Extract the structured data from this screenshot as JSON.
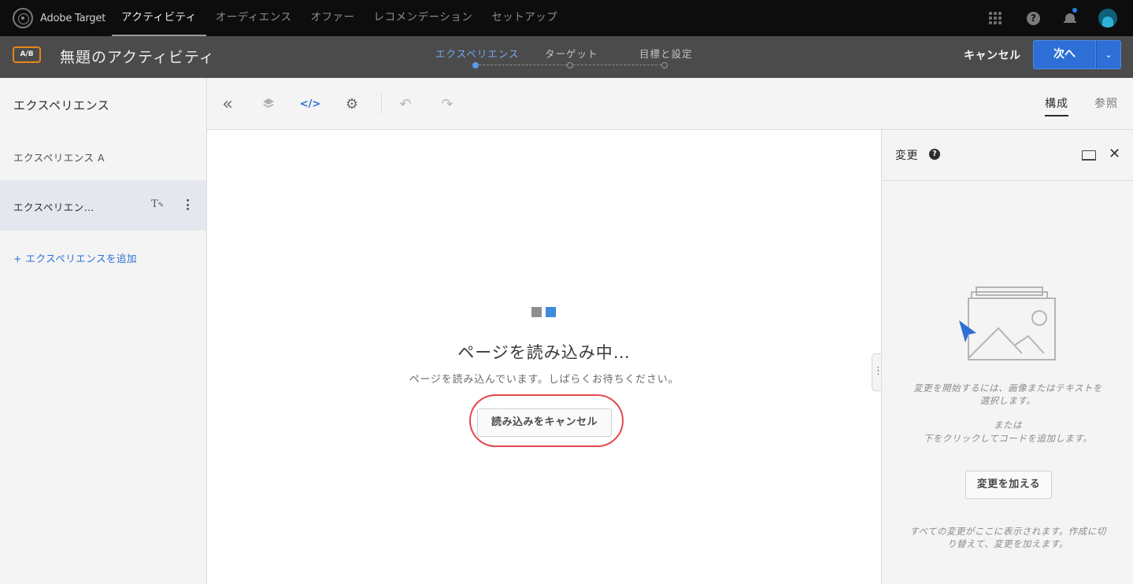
{
  "topnav": {
    "brand": "Adobe Target",
    "items": [
      {
        "label": "アクティビティ",
        "active": true
      },
      {
        "label": "オーディエンス",
        "active": false
      },
      {
        "label": "オファー",
        "active": false
      },
      {
        "label": "レコメンデーション",
        "active": false
      },
      {
        "label": "セットアップ",
        "active": false
      }
    ],
    "help_glyph": "?"
  },
  "activity": {
    "badge": "A/B",
    "title": "無題のアクティビティ",
    "steps": [
      {
        "label": "エクスペリエンス",
        "active": true
      },
      {
        "label": "ターゲット",
        "active": false
      },
      {
        "label": "目標と設定",
        "active": false
      }
    ],
    "cancel_label": "キャンセル",
    "next_label": "次へ",
    "dropdown_glyph": "⌄"
  },
  "sidebar": {
    "heading": "エクスペリエンス",
    "experience_a": "エクスペリエンス A",
    "selected_experience": "エクスペリエン…",
    "rename_glyph": "T",
    "add_label": "+ エクスペリエンスを追加"
  },
  "toolbar": {
    "icons": [
      "collapse-icon",
      "layers-icon",
      "code-icon",
      "settings-icon",
      "undo-icon",
      "redo-icon"
    ],
    "collapse_glyph": "«",
    "code_glyph": "</>",
    "settings_glyph": "⚙",
    "undo_glyph": "↶",
    "redo_glyph": "↷",
    "tab_compose": "構成",
    "tab_browse": "参照"
  },
  "canvas": {
    "loading_title": "ページを読み込み中…",
    "loading_sub": "ページを読み込んでいます。しばらくお待ちください。",
    "cancel_loading": "読み込みをキャンセル"
  },
  "changes_panel": {
    "title": "変更",
    "help_glyph": "?",
    "close_glyph": "✕",
    "instruction_1": "変更を開始するには、画像またはテキストを選択します。",
    "or": "または",
    "instruction_2": "下をクリックしてコードを追加します。",
    "add_change_label": "変更を加える",
    "footer": "すべての変更がここに表示されます。作成に切り替えて、変更を加えます。"
  },
  "colors": {
    "accent_blue": "#2d6fd6",
    "badge_orange": "#e68619",
    "highlight_red": "#e5484d"
  }
}
